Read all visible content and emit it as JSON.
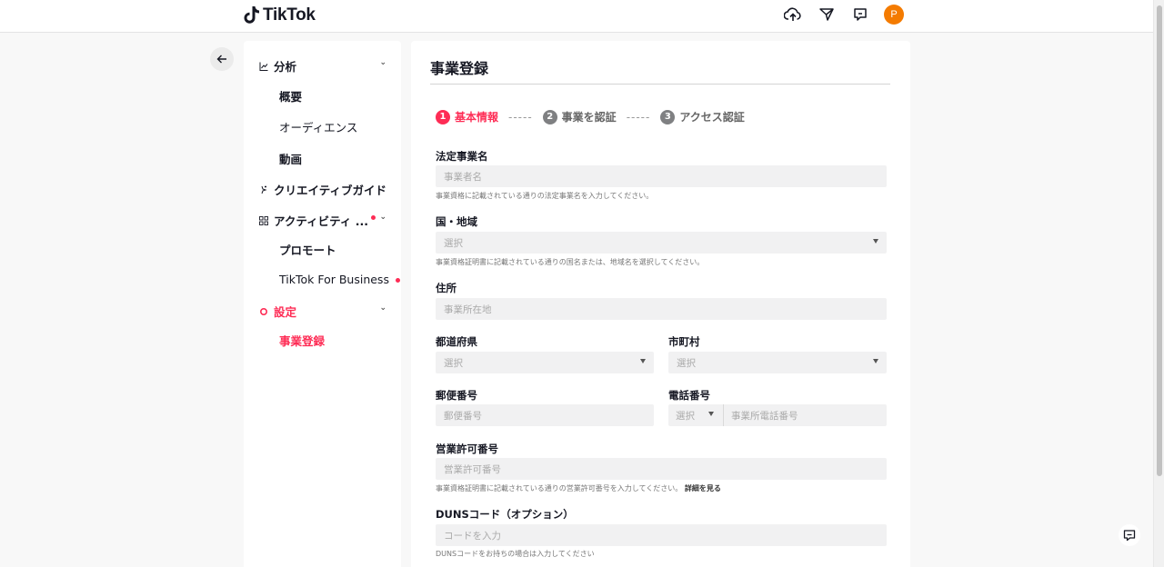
{
  "header": {
    "logo_text": "TikTok",
    "icons": [
      "cloud-upload-icon",
      "send-icon",
      "message-icon"
    ],
    "avatar_initial": "P",
    "avatar_color": "#f47b00"
  },
  "sidebar": {
    "groups": {
      "analytics": "分析",
      "creative_guide": "クリエイティブガイド",
      "activity": "アクティビティ ...",
      "settings": "設定"
    },
    "items": {
      "overview": "概要",
      "audience": "オーディエンス",
      "video": "動画",
      "promote": "プロモート",
      "tiktok_for_business": "TikTok For Business",
      "business_registration": "事業登録"
    }
  },
  "main": {
    "title": "事業登録",
    "steps": [
      {
        "num": "1",
        "label": "基本情報"
      },
      {
        "num": "2",
        "label": "事業を認証"
      },
      {
        "num": "3",
        "label": "アクセス認証"
      }
    ],
    "step_separator": "-----",
    "fields": {
      "legal_name": {
        "label": "法定事業名",
        "placeholder": "事業者名",
        "hint": "事業資格に記載されている通りの法定事業名を入力してください。"
      },
      "country": {
        "label": "国・地域",
        "placeholder": "選択",
        "hint": "事業資格証明書に記載されている通りの国名または、地域名を選択してください。"
      },
      "address": {
        "label": "住所",
        "placeholder": "事業所在地"
      },
      "prefecture": {
        "label": "都道府県",
        "placeholder": "選択"
      },
      "city": {
        "label": "市町村",
        "placeholder": "選択"
      },
      "postal_code": {
        "label": "郵便番号",
        "placeholder": "郵便番号"
      },
      "phone": {
        "label": "電話番号",
        "prefix_placeholder": "選択",
        "placeholder": "事業所電話番号"
      },
      "license": {
        "label": "営業許可番号",
        "placeholder": "営業許可番号",
        "hint": "事業資格証明書に記載されている通りの営業許可番号を入力してください。",
        "hint_link": "詳細を見る"
      },
      "duns": {
        "label": "DUNSコード（オプション）",
        "placeholder": "コードを入力",
        "hint": "DUNSコードをお持ちの場合は入力してください"
      }
    }
  },
  "colors": {
    "accent": "#fe2c55",
    "field_bg": "#f1f1f2",
    "page_bg": "#f8f8f8"
  }
}
